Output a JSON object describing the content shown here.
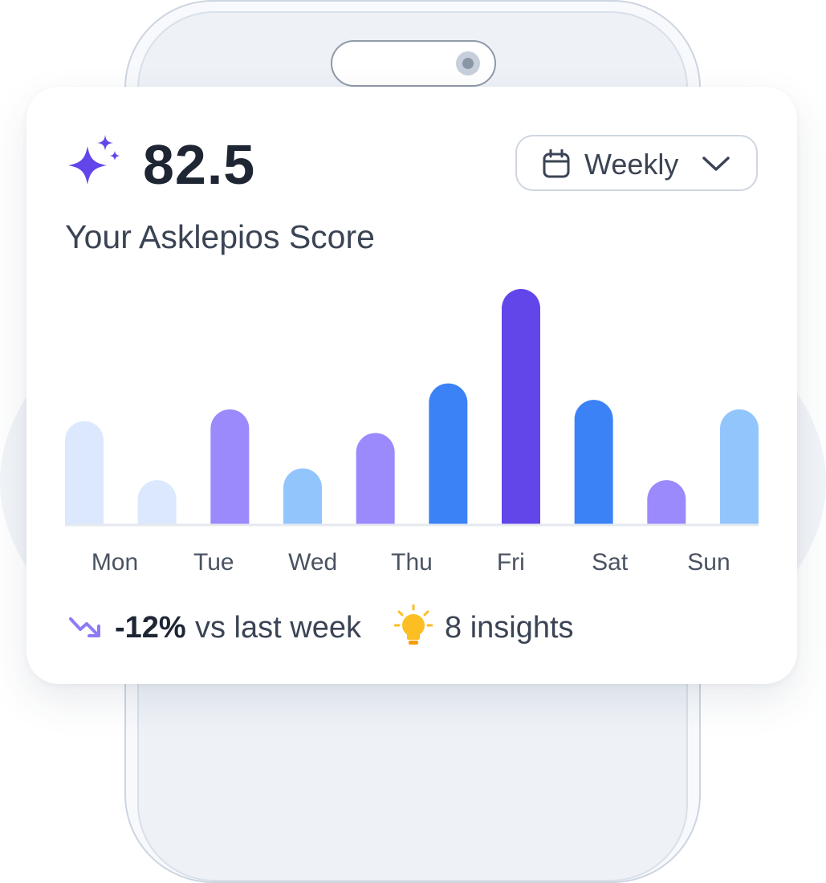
{
  "colors": {
    "accent": "#6246ea",
    "text_dark": "#1e2533",
    "text_muted": "#3b4454",
    "bulb": "#fbbf24"
  },
  "header": {
    "score": "82.5",
    "score_icon": "sparkle-icon",
    "subtitle": "Your Asklepios Score"
  },
  "period_selector": {
    "label": "Weekly",
    "icon": "calendar-icon"
  },
  "chart_data": {
    "type": "bar",
    "categories": [
      "Mon",
      "",
      "Tue",
      "",
      "Wed",
      "",
      "Thu",
      "",
      "Fri",
      "",
      "Sat",
      "",
      "Sun"
    ],
    "x_labels": [
      "Mon",
      "Tue",
      "Wed",
      "Thu",
      "Fri",
      "Sat",
      "Sun"
    ],
    "values": [
      44,
      19,
      49,
      24,
      39,
      60,
      100,
      53,
      19,
      49
    ],
    "bar_colors": [
      "#dbe8fd",
      "#dbe8fd",
      "#9b8afb",
      "#93c5fd",
      "#9b8afb",
      "#3b82f6",
      "#6246ea",
      "#3b82f6",
      "#9b8afb",
      "#93c5fd"
    ],
    "ylim": [
      0,
      100
    ],
    "grid": false
  },
  "footer": {
    "trend_icon": "trending-down-icon",
    "trend_value": "-12%",
    "trend_text": "vs last week",
    "insights_icon": "lightbulb-icon",
    "insights_text": "8 insights"
  }
}
